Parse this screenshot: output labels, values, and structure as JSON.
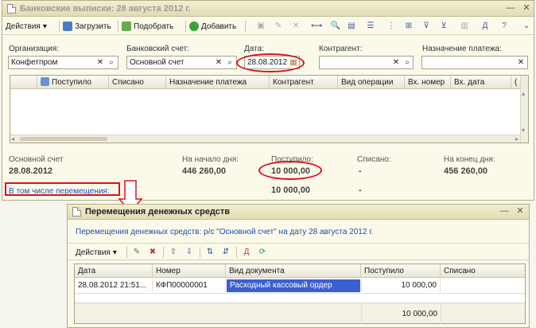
{
  "main_window": {
    "title": "Банковские выписки: 28 августа 2012 г.",
    "toolbar": {
      "actions_label": "Действия",
      "load_label": "Загрузить",
      "pick_label": "Подобрать",
      "add_label": "Добавить"
    },
    "filters": {
      "organization": {
        "label": "Организация:",
        "value": "Конфетпром"
      },
      "bank_account": {
        "label": "Банковский счет:",
        "value": "Основной счет"
      },
      "date": {
        "label": "Дата:",
        "value": "28.08.2012"
      },
      "counterparty": {
        "label": "Контрагент:",
        "value": ""
      },
      "payment_purpose": {
        "label": "Назначение платежа:",
        "value": ""
      }
    },
    "table": {
      "columns": [
        "Поступило",
        "Списано",
        "Назначение платежа",
        "Контрагент",
        "Вид операции",
        "Вх. номер",
        "Вх. дата",
        "("
      ],
      "rows": []
    },
    "summary": {
      "account_label": "Основной счет",
      "account_date": "28.08.2012",
      "start_label": "На начало дня:",
      "start_value": "446 260,00",
      "received_label": "Поступило:",
      "received_value": "10 000,00",
      "received_transfers_value": "10 000,00",
      "spent_label": "Списано:",
      "spent_value": "-",
      "spent_transfers_value": "-",
      "end_label": "На конец дня:",
      "end_value": "456 260,00",
      "transfers_link": "В том числе перемещения:"
    }
  },
  "sub_window": {
    "title": "Перемещения денежных средств",
    "subtitle": "Перемещения денежных средств: р/с \"Основной счет\" на дату 28 августа 2012 г.",
    "actions_label": "Действия",
    "table": {
      "columns": [
        "Дата",
        "Номер",
        "Вид документа",
        "Поступило",
        "Списано"
      ],
      "rows": [
        {
          "date": "28.08.2012 21:51...",
          "number": "КФП00000001",
          "doc_type": "Расходный кассовый ордер",
          "received": "10 000,00",
          "spent": ""
        }
      ],
      "total_received": "10 000,00"
    }
  },
  "colors": {
    "annotation_red": "#d8141c",
    "selection_blue": "#3c5fd0",
    "link_blue": "#1c4fc1",
    "window_bg": "#fbf9ea"
  }
}
